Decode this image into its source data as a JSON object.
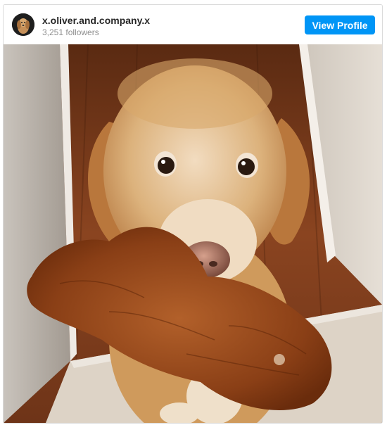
{
  "profile": {
    "username": "x.oliver.and.company.x",
    "followers": "3,251 followers",
    "view_profile_label": "View Profile",
    "avatar_icon": "dog-avatar-icon"
  },
  "post": {
    "image_icon": "dog-photo",
    "colors": {
      "button": "#0095f6",
      "floor_wood": "#7a3a1a",
      "dog_fur": "#d9a96b",
      "toy": "#9b4a1c"
    }
  }
}
